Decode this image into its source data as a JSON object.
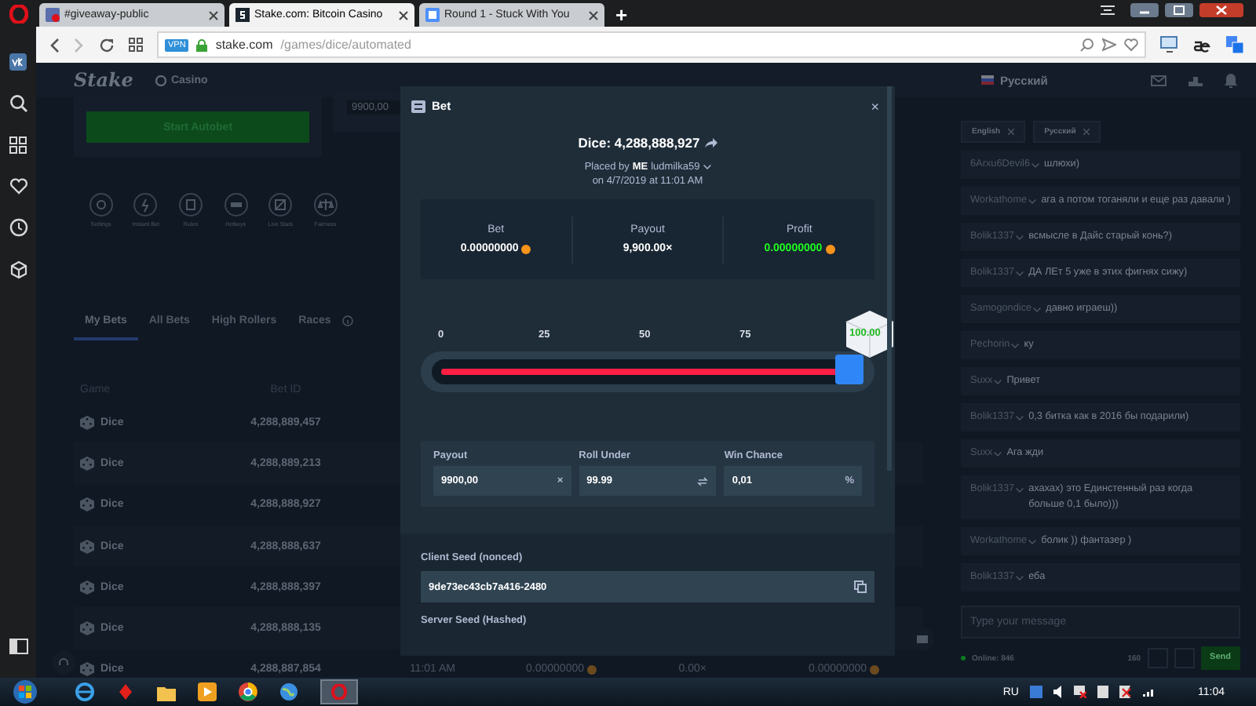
{
  "browser": {
    "tabs": [
      {
        "title": "#giveaway-public",
        "selected": false
      },
      {
        "title": "Stake.com: Bitcoin Casino",
        "selected": true
      },
      {
        "title": "Round 1 - Stuck With You",
        "selected": false
      }
    ],
    "new_tab": "+",
    "vpn": "VPN",
    "url_host": "stake.com",
    "url_path": "/games/dice/automated"
  },
  "header": {
    "logo": "Stake",
    "nav": "Casino",
    "language": "Русский"
  },
  "game": {
    "autobet_button": "Start Autobet",
    "payout_field": "9900,00",
    "tools": [
      "Settings",
      "Instant Bet",
      "Rules",
      "Hotkeys",
      "Live Stats",
      "Fairness"
    ],
    "bet_tabs": [
      {
        "label": "My Bets",
        "selected": true
      },
      {
        "label": "All Bets",
        "selected": false
      },
      {
        "label": "High Rollers",
        "selected": false
      },
      {
        "label": "Races",
        "selected": false
      }
    ]
  },
  "bets_table": {
    "columns": [
      "Game",
      "Bet ID"
    ],
    "rows": [
      {
        "game": "Dice",
        "bet_id": "4,288,889,457"
      },
      {
        "game": "Dice",
        "bet_id": "4,288,889,213"
      },
      {
        "game": "Dice",
        "bet_id": "4,288,888,927"
      },
      {
        "game": "Dice",
        "bet_id": "4,288,888,637"
      },
      {
        "game": "Dice",
        "bet_id": "4,288,888,397"
      },
      {
        "game": "Dice",
        "bet_id": "4,288,888,135"
      },
      {
        "game": "Dice",
        "bet_id": "4,288,887,854",
        "time": "11:01 AM",
        "bet": "0.00000000",
        "multiplier": "0.00×",
        "payout": "0.00000000"
      }
    ]
  },
  "modal": {
    "title": "Bet",
    "close": "×",
    "bet_title": "Dice: 4,288,888,927",
    "placed_by": "Placed by",
    "badge": "ME",
    "user": "ludmilka59",
    "date": "on 4/7/2019 at 11:01 AM",
    "stats": [
      {
        "label": "Bet",
        "value": "0.00000000",
        "coin": true,
        "positive": false
      },
      {
        "label": "Payout",
        "value": "9,900.00×",
        "coin": false,
        "positive": false
      },
      {
        "label": "Profit",
        "value": "0.00000000",
        "coin": true,
        "positive": true
      }
    ],
    "slider": {
      "ticks": [
        "0",
        "25",
        "50",
        "75"
      ],
      "level": 0.9999,
      "result": "100.00"
    },
    "fields": [
      {
        "label": "Payout",
        "value": "9900,00",
        "unit": "×"
      },
      {
        "label": "Roll Under",
        "value": "99.99"
      },
      {
        "label": "Win Chance",
        "value": "0,01",
        "unit": "%"
      }
    ],
    "client_seed_label": "Client Seed (nonced)",
    "client_seed": "9de73ec43cb7a416-2480",
    "server_seed_label": "Server Seed (Hashed)"
  },
  "chat": {
    "languages": [
      "English",
      "Русский"
    ],
    "messages": [
      {
        "user": "6Arxu6Devil6",
        "text": "шлюхи)"
      },
      {
        "user": "Workathome",
        "text": "ага а потом тоганяли и еще раз давали )"
      },
      {
        "user": "Bolik1337",
        "text": "всмысле в Дайс старый конь?)"
      },
      {
        "user": "Bolik1337",
        "text": "ДА ЛЕт 5 уже в этих фигнях сижу)"
      },
      {
        "user": "Samogondice",
        "text": "давно играеш))"
      },
      {
        "user": "Pechorin",
        "text": "ку"
      },
      {
        "user": "Suxx",
        "text": "Привет"
      },
      {
        "user": "Bolik1337",
        "text": "0,3 битка как в 2016 бы подарили)"
      },
      {
        "user": "Suxx",
        "text": "Ага жди"
      },
      {
        "user": "Bolik1337",
        "text": "ахахах) это Единстенный раз когда больше 0,1 было)))"
      },
      {
        "user": "Workathome",
        "text": "болик )) фантазер )"
      },
      {
        "user": "Bolik1337",
        "text": "еба"
      }
    ],
    "placeholder": "Type your message",
    "online": "Online: 846",
    "count": "160",
    "send": "Send"
  },
  "taskbar": {
    "language": "RU",
    "time": "11:04"
  }
}
